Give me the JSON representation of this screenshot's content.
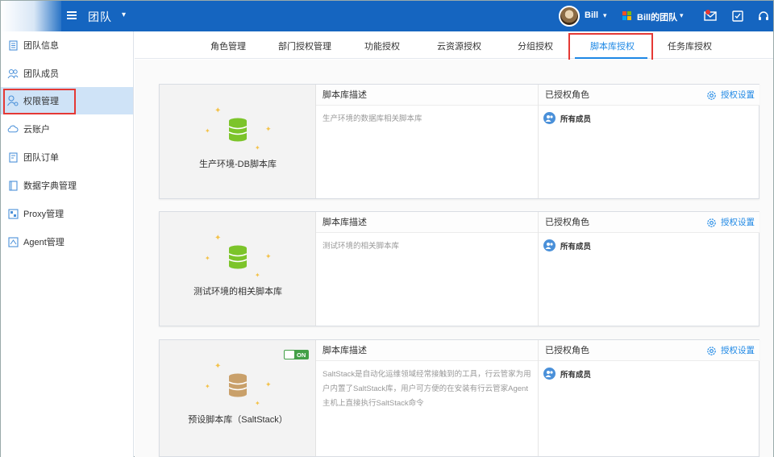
{
  "header": {
    "team_title": "团队",
    "user_name": "Bill",
    "team_switch": "Bill的团队",
    "icons": [
      "menu-icon",
      "avatar",
      "microsoft-logo",
      "mail-icon",
      "task-icon",
      "headset-icon"
    ],
    "colors": {
      "topbar": "#1565c0",
      "accent": "#1e88e5",
      "notify": "#e53935"
    }
  },
  "sidebar": {
    "items": [
      {
        "label": "团队信息",
        "icon": "team-info-icon"
      },
      {
        "label": "团队成员",
        "icon": "team-members-icon"
      },
      {
        "label": "权限管理",
        "icon": "permission-icon",
        "active": true
      },
      {
        "label": "云账户",
        "icon": "cloud-icon"
      },
      {
        "label": "团队订单",
        "icon": "order-icon"
      },
      {
        "label": "数据字典管理",
        "icon": "dictionary-icon"
      },
      {
        "label": "Proxy管理",
        "icon": "proxy-icon"
      },
      {
        "label": "Agent管理",
        "icon": "agent-icon"
      }
    ]
  },
  "tabs": [
    {
      "label": "角色管理"
    },
    {
      "label": "部门授权管理"
    },
    {
      "label": "功能授权"
    },
    {
      "label": "云资源授权"
    },
    {
      "label": "分组授权"
    },
    {
      "label": "脚本库授权",
      "active": true
    },
    {
      "label": "任务库授权"
    }
  ],
  "cards": [
    {
      "name": "生产环境-DB脚本库",
      "desc_header": "脚本库描述",
      "description": "生产环境的数据库相关脚本库",
      "role_header": "已授权角色",
      "auth_label": "授权设置",
      "roles": [
        "所有成员"
      ],
      "icon_color": "#7cc42a"
    },
    {
      "name": "测试环境的相关脚本库",
      "desc_header": "脚本库描述",
      "description": "测试环境的相关脚本库",
      "role_header": "已授权角色",
      "auth_label": "授权设置",
      "roles": [
        "所有成员"
      ],
      "icon_color": "#7cc42a"
    },
    {
      "name": "预设脚本库（SaltStack）",
      "desc_header": "脚本库描述",
      "description": "SaltStack是自动化运维领域经常接触到的工具，行云管家为用户内置了SaltStack库，用户可方便的在安装有行云管家Agent主机上直接执行SaltStack命令",
      "role_header": "已授权角色",
      "auth_label": "授权设置",
      "roles": [
        "所有成员"
      ],
      "toggle_label": "ON",
      "icon_color": "#c9a06a"
    }
  ]
}
